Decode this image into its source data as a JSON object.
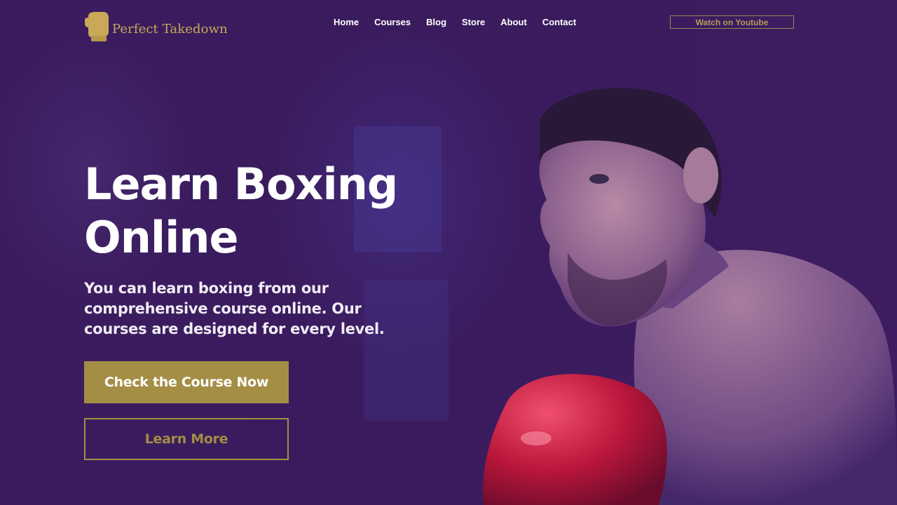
{
  "brand": {
    "name": "Perfect Takedown",
    "logo_icon": "boxing-glove-icon",
    "accent_color": "#a48e45",
    "background_color": "#3a1c5e"
  },
  "nav": {
    "items": [
      {
        "label": "Home"
      },
      {
        "label": "Courses"
      },
      {
        "label": "Blog"
      },
      {
        "label": "Store"
      },
      {
        "label": "About"
      },
      {
        "label": "Contact"
      }
    ]
  },
  "header": {
    "youtube_button_label": "Watch on Youtube"
  },
  "hero": {
    "title_line1": "Learn Boxing",
    "title_line2": "Online",
    "subtitle": "You can learn boxing from our comprehensive course online. Our courses are designed for every level.",
    "primary_button_label": "Check the Course Now",
    "secondary_button_label": "Learn More"
  }
}
